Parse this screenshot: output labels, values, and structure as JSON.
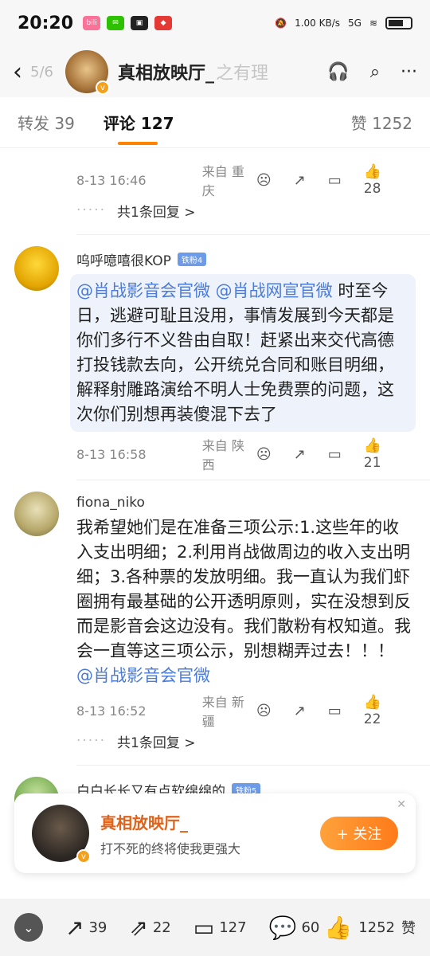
{
  "status": {
    "time": "20:20",
    "net": "1.00 KB/s",
    "signal": "5G"
  },
  "header": {
    "page_indicator": "5/6",
    "title": "真相放映厅_",
    "ghost_text": "之有理"
  },
  "tabs": {
    "repost": "转发 39",
    "comments": "评论 127",
    "likes": "赞 1252"
  },
  "comments": [
    {
      "time": "8-13 16:46",
      "location": "来自 重庆",
      "likes": "28",
      "reply_text": "共1条回复 >"
    },
    {
      "name": "呜呼噫嘻很KOP",
      "badge": "铁粉4",
      "mentions": "@肖战影音会官微 @肖战网宣官微",
      "text": "时至今日，逃避可耻且没用，事情发展到今天都是你们多行不义咎由自取！赶紧出来交代高德打投钱款去向，公开统兑合同和账目明细，解释射雕路演给不明人士免费票的问题，这次你们别想再装傻混下去了",
      "time": "8-13 16:58",
      "location": "来自 陕西",
      "likes": "21"
    },
    {
      "name": "fiona_niko",
      "text": "我希望她们是在准备三项公示:1.这些年的收入支出明细；2.利用肖战做周边的收入支出明细；3.各种票的发放明细。我一直认为我们虾圈拥有最基础的公开透明原则，实在没想到反而是影音会这边没有。我们散粉有权知道。我会一直等这三项公示，别想糊弄过去！！！",
      "mention": "@肖战影音会官微",
      "time": "8-13 16:52",
      "location": "来自 新疆",
      "likes": "22",
      "reply_text": "共1条回复 >"
    },
    {
      "name": "白白长长又有点软绵绵的",
      "badge": "铁粉5"
    }
  ],
  "follow_card": {
    "name": "真相放映厅_",
    "subtitle": "打不死的终将使我更强大",
    "button": "+ 关注"
  },
  "bottom_bar": {
    "repost": "39",
    "share": "22",
    "comments": "127",
    "bubble": "60",
    "likes": "1252",
    "like_label": "赞"
  },
  "colors": {
    "accent": "#ff8200",
    "mention": "#4b7bd6",
    "follow": "#ff7a1a"
  }
}
